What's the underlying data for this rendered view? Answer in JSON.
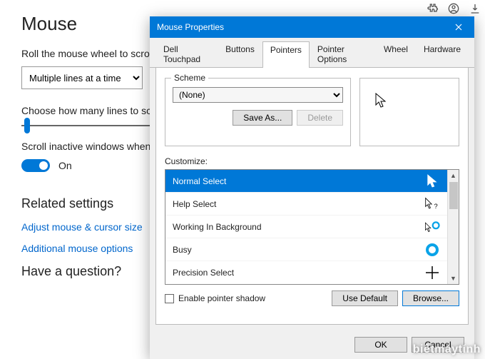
{
  "browser": {
    "ext": "✦",
    "account": "◯",
    "download": "⬇"
  },
  "settings": {
    "title": "Mouse",
    "wheel_label": "Roll the mouse wheel to scroll",
    "wheel_value": "Multiple lines at a time",
    "lines_label": "Choose how many lines to scroll",
    "inactive_label": "Scroll inactive windows when hovered",
    "toggle_text": "On",
    "related_head": "Related settings",
    "link_cursor": "Adjust mouse & cursor size",
    "link_additional": "Additional mouse options",
    "question_head": "Have a question?"
  },
  "dialog": {
    "title": "Mouse Properties",
    "tabs": [
      "Dell Touchpad",
      "Buttons",
      "Pointers",
      "Pointer Options",
      "Wheel",
      "Hardware"
    ],
    "scheme": {
      "legend": "Scheme",
      "value": "(None)",
      "save": "Save As...",
      "delete": "Delete"
    },
    "customize_label": "Customize:",
    "items": [
      {
        "label": "Normal Select"
      },
      {
        "label": "Help Select"
      },
      {
        "label": "Working In Background"
      },
      {
        "label": "Busy"
      },
      {
        "label": "Precision Select"
      }
    ],
    "shadow_label": "Enable pointer shadow",
    "use_default": "Use Default",
    "browse": "Browse...",
    "ok": "OK",
    "cancel": "Cancel"
  },
  "watermark": "biếtmáytính"
}
